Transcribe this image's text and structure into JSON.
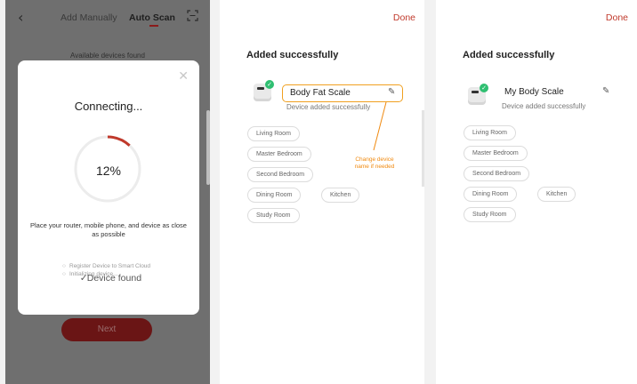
{
  "panel1": {
    "back_icon": "chevron-left-icon",
    "tabs": [
      "Add Manually",
      "Auto Scan"
    ],
    "scan_icon": "scan-frame-icon",
    "available_text": "Available devices found",
    "next_label": "Next",
    "modal": {
      "close_icon": "close-icon",
      "title": "Connecting...",
      "progress_text": "12%",
      "progress": 0.12,
      "hint": "Place your router, mobile phone, and device as close as possible",
      "steps": [
        {
          "label": "Device found",
          "status": "done"
        },
        {
          "label": "Register Device to Smart Cloud",
          "status": "pending"
        },
        {
          "label": "Initializing device...",
          "status": "pending"
        }
      ]
    },
    "colors": {
      "accent": "#8b1a1a",
      "ring": "#c0392b"
    }
  },
  "panel2": {
    "done_label": "Done",
    "added_title": "Added successfully",
    "device_name": "Body Fat Scale",
    "device_status": "Device added successfully",
    "annotation": "Change device name if needed",
    "rooms": [
      "Living Room",
      "Master Bedroom",
      "Second Bedroom",
      "Dining Room",
      "Kitchen",
      "Study Room"
    ]
  },
  "panel3": {
    "done_label": "Done",
    "added_title": "Added successfully",
    "device_name": "My Body Scale",
    "device_status": "Device added successfully",
    "rooms": [
      "Living Room",
      "Master Bedroom",
      "Second Bedroom",
      "Dining Room",
      "Kitchen",
      "Study Room"
    ]
  },
  "colors": {
    "done": "#c0392b",
    "highlight": "#f0a020",
    "success": "#2fbf71"
  }
}
